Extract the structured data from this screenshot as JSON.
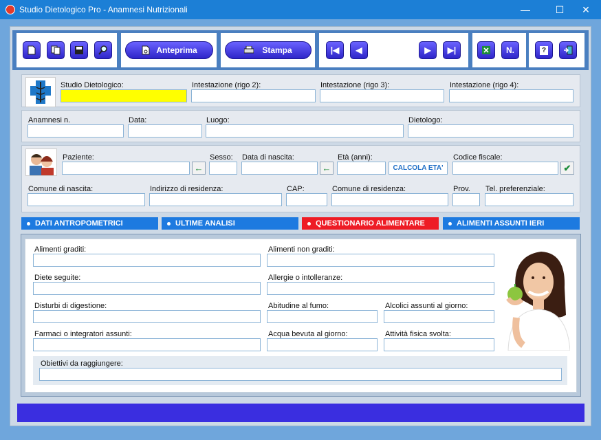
{
  "window": {
    "title": "Studio Dietologico Pro - Anamnesi Nutrizionali",
    "minimize": "—",
    "maximize": "☐",
    "close": "✕"
  },
  "toolbar": {
    "preview_label": "Anteprima",
    "print_label": "Stampa",
    "notes_label": "N.",
    "help_label": "?"
  },
  "header": {
    "studio_label": "Studio Dietologico:",
    "studio_value": "",
    "line2_label": "Intestazione (rigo 2):",
    "line3_label": "Intestazione (rigo 3):",
    "line4_label": "Intestazione (rigo 4):"
  },
  "record": {
    "number_label": "Anamnesi n.",
    "date_label": "Data:",
    "place_label": "Luogo:",
    "dietologist_label": "Dietologo:"
  },
  "patient": {
    "name_label": "Paziente:",
    "sex_label": "Sesso:",
    "birthdate_label": "Data di nascita:",
    "age_label": "Età (anni):",
    "calc_age_label": "CALCOLA ETA'",
    "tax_code_label": "Codice fiscale:",
    "birthplace_label": "Comune di nascita:",
    "address_label": "Indirizzo di residenza:",
    "zip_label": "CAP:",
    "residence_label": "Comune di residenza:",
    "province_label": "Prov.",
    "phone_label": "Tel. preferenziale:"
  },
  "tabs": [
    {
      "label": "DATI ANTROPOMETRICI",
      "color": "#1d7ae0"
    },
    {
      "label": "ULTIME ANALISI",
      "color": "#1d7ae0"
    },
    {
      "label": "QUESTIONARIO ALIMENTARE",
      "color": "#ee1c25"
    },
    {
      "label": "ALIMENTI ASSUNTI IERI",
      "color": "#1d7ae0"
    }
  ],
  "questionnaire": {
    "liked_foods": "Alimenti graditi:",
    "disliked_foods": "Alimenti non graditi:",
    "diets": "Diete seguite:",
    "allergies": "Allergie o intolleranze:",
    "digestion": "Disturbi di digestione:",
    "smoking": "Abitudine al fumo:",
    "alcohol": "Alcolici assunti al giorno:",
    "drugs": "Farmaci o integratori assunti:",
    "water": "Acqua bevuta al giorno:",
    "activity": "Attività fisica svolta:",
    "goals": "Obiettivi da raggiungere:"
  },
  "colors": {
    "title_bar": "#1c7fd6",
    "button": "#3a31d8",
    "footer_bar": "#3a2ee0",
    "highlight_field": "#ffff00"
  }
}
